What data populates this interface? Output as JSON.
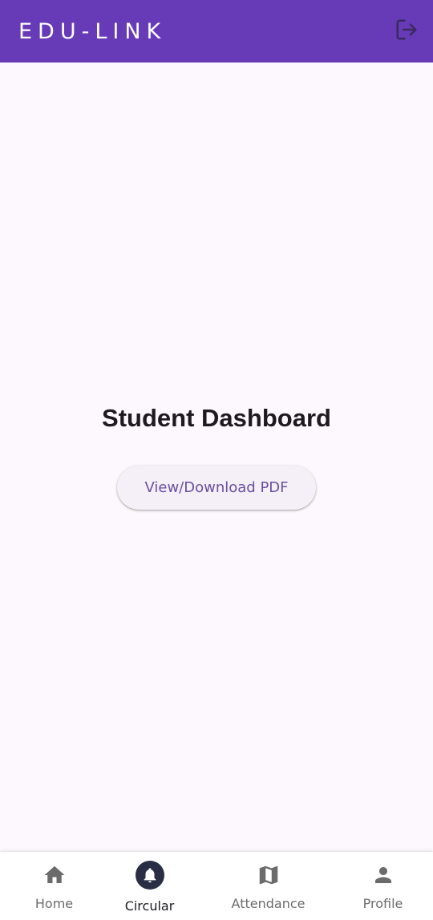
{
  "app_bar": {
    "title": "EDU-LINK",
    "logout_icon": "logout-icon"
  },
  "main": {
    "title": "Student Dashboard",
    "pdf_button_label": "View/Download PDF"
  },
  "bottom_nav": {
    "items": [
      {
        "label": "Home",
        "icon": "home-icon",
        "active": false
      },
      {
        "label": "Circular",
        "icon": "bell-icon",
        "active": true
      },
      {
        "label": "Attendance",
        "icon": "map-icon",
        "active": false
      },
      {
        "label": "Profile",
        "icon": "person-icon",
        "active": false
      }
    ]
  },
  "colors": {
    "app_bar": "#673ab7",
    "background": "#fdf8fd",
    "button_bg": "#f5f0f8",
    "button_text": "#6b4ea0",
    "active_nav": "#2a2e45",
    "inactive_nav": "#6b6b6b"
  }
}
